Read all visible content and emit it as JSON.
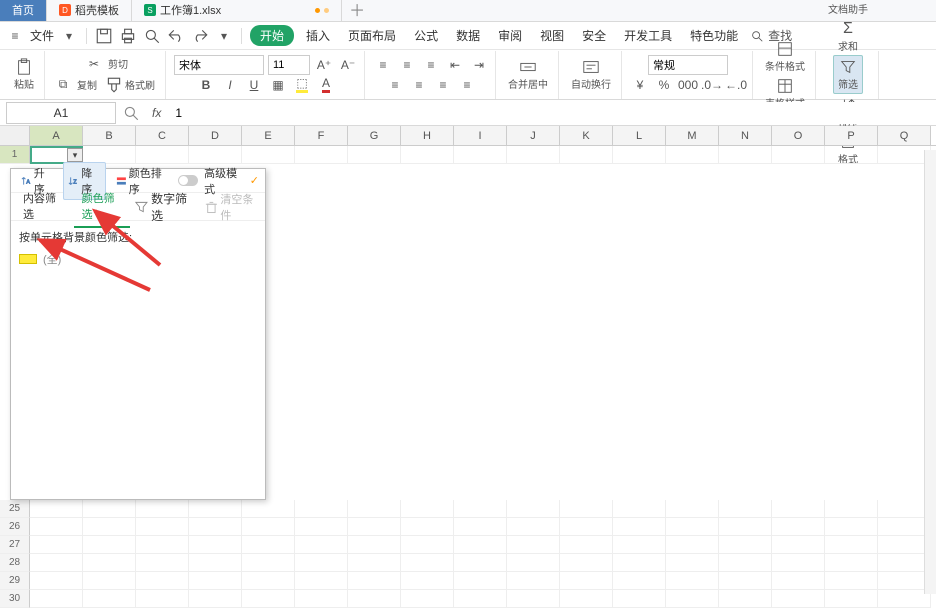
{
  "tabs": [
    {
      "label": "首页"
    },
    {
      "label": "稻壳模板"
    },
    {
      "label": "工作簿1.xlsx"
    }
  ],
  "newtab_glyph": "＋",
  "filerow": {
    "file_label": "文件",
    "hamburger": "≡",
    "dropdown": "▾"
  },
  "menus": {
    "start": "开始",
    "insert": "插入",
    "pagelayout": "页面布局",
    "formula": "公式",
    "data": "数据",
    "review": "审阅",
    "view": "视图",
    "security": "安全",
    "devtools": "开发工具",
    "special": "特色功能",
    "search": "查找"
  },
  "ribbon": {
    "paste": "粘贴",
    "cut": "剪切",
    "copy": "复制",
    "format_painter": "格式刷",
    "font_name": "宋体",
    "font_size": "11",
    "bold": "B",
    "italic": "I",
    "underline": "U",
    "merge": "合并居中",
    "wrap": "自动换行",
    "number_format": "常规",
    "cond_format": "条件格式",
    "table_style": "表格样式",
    "doc_helper": "文档助手",
    "sum": "求和",
    "filter": "筛选",
    "sort": "排序",
    "format": "格式"
  },
  "namebox": "A1",
  "fx_label": "fx",
  "formula_value": "1",
  "columns": [
    "A",
    "B",
    "C",
    "D",
    "E",
    "F",
    "G",
    "H",
    "I",
    "J",
    "K",
    "L",
    "M",
    "N",
    "O",
    "P",
    "Q"
  ],
  "rows_visible_first": [
    "1"
  ],
  "rows_visible_tail": [
    "25",
    "26",
    "27",
    "28",
    "29",
    "30"
  ],
  "popup": {
    "asc": "升序",
    "desc": "降序",
    "color_sort": "颜色排序",
    "adv_mode": "高级模式",
    "vip_mark": "✓",
    "tab_content": "内容筛选",
    "tab_color": "颜色筛选",
    "num_filter": "数字筛选",
    "clear_cond": "清空条件",
    "body_label": "按单元格背景颜色筛选:",
    "swatch_text": "(全)"
  }
}
